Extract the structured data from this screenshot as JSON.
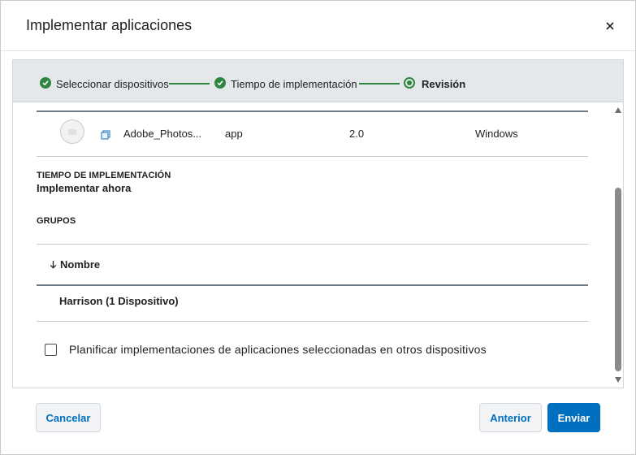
{
  "dialog": {
    "title": "Implementar aplicaciones",
    "close_icon": "close-icon"
  },
  "stepper": {
    "steps": [
      {
        "label": "Seleccionar dispositivos",
        "state": "complete",
        "icon": "check-circle-icon"
      },
      {
        "label": "Tiempo de implementación",
        "state": "complete",
        "icon": "check-circle-icon"
      },
      {
        "label": "Revisión",
        "state": "current",
        "icon": "radio-current-icon"
      }
    ],
    "color_complete": "#2e8540"
  },
  "app": {
    "name": "Adobe_Photos...",
    "type": "app",
    "version": "2.0",
    "platform": "Windows",
    "icon": "copy-icon"
  },
  "deployment_time": {
    "label": "TIEMPO DE IMPLEMENTACIÓN",
    "value": "Implementar ahora"
  },
  "groups": {
    "label": "GRUPOS",
    "column_header": "Nombre",
    "sort_icon": "arrow-down-icon",
    "rows": [
      {
        "name": "Harrison (1 Dispositivo)"
      }
    ]
  },
  "schedule_option": {
    "label": "Planificar implementaciones de aplicaciones seleccionadas en otros dispositivos",
    "checked": false
  },
  "footer": {
    "cancel_label": "Cancelar",
    "previous_label": "Anterior",
    "submit_label": "Enviar"
  },
  "colors": {
    "primary": "#006fbf",
    "success": "#2e8540"
  }
}
